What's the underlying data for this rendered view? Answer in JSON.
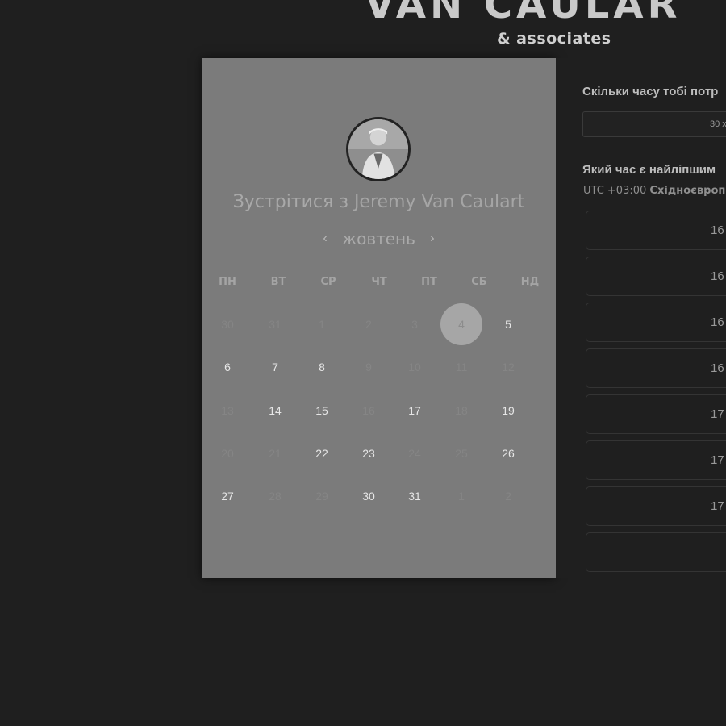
{
  "brand": {
    "title": "VAN CAULAR",
    "subtitle": "& associates"
  },
  "booking": {
    "meet_prefix": "Зустрітися з ",
    "host_name": "Jeremy Van Caulart",
    "calendar": {
      "prev_icon": "‹",
      "next_icon": "›",
      "month": "жовтень",
      "weekdays": [
        "ПН",
        "ВТ",
        "СР",
        "ЧТ",
        "ПТ",
        "СБ",
        "НД"
      ],
      "weeks": [
        [
          {
            "d": "30",
            "s": "muted"
          },
          {
            "d": "31",
            "s": "muted"
          },
          {
            "d": "1",
            "s": "muted"
          },
          {
            "d": "2",
            "s": "muted"
          },
          {
            "d": "3",
            "s": "muted"
          },
          {
            "d": "4",
            "s": "selected"
          },
          {
            "d": "5",
            "s": "avail"
          }
        ],
        [
          {
            "d": "6",
            "s": "avail"
          },
          {
            "d": "7",
            "s": "avail"
          },
          {
            "d": "8",
            "s": "avail"
          },
          {
            "d": "9",
            "s": "muted"
          },
          {
            "d": "10",
            "s": "muted"
          },
          {
            "d": "11",
            "s": "muted"
          },
          {
            "d": "12",
            "s": "muted"
          }
        ],
        [
          {
            "d": "13",
            "s": "muted"
          },
          {
            "d": "14",
            "s": "avail"
          },
          {
            "d": "15",
            "s": "avail"
          },
          {
            "d": "16",
            "s": "muted"
          },
          {
            "d": "17",
            "s": "avail"
          },
          {
            "d": "18",
            "s": "muted"
          },
          {
            "d": "19",
            "s": "avail"
          }
        ],
        [
          {
            "d": "20",
            "s": "muted"
          },
          {
            "d": "21",
            "s": "muted"
          },
          {
            "d": "22",
            "s": "avail"
          },
          {
            "d": "23",
            "s": "avail"
          },
          {
            "d": "24",
            "s": "muted"
          },
          {
            "d": "25",
            "s": "muted"
          },
          {
            "d": "26",
            "s": "avail"
          }
        ],
        [
          {
            "d": "27",
            "s": "avail"
          },
          {
            "d": "28",
            "s": "muted"
          },
          {
            "d": "29",
            "s": "muted"
          },
          {
            "d": "30",
            "s": "avail"
          },
          {
            "d": "31",
            "s": "avail"
          },
          {
            "d": "1",
            "s": "muted"
          },
          {
            "d": "2",
            "s": "muted"
          }
        ]
      ]
    },
    "duration": {
      "question": "Скільки часу тобі потр",
      "value": "30 х"
    },
    "time": {
      "question": "Який час є найліпшим",
      "tz_offset": "UTC +03:00 ",
      "tz_name": "Східноєвроп",
      "slots": [
        "16",
        "16",
        "16",
        "16",
        "17",
        "17",
        "17",
        ""
      ]
    }
  },
  "colors": {
    "page_bg": "#1f1f1f",
    "left_panel_bg": "#7b7b7b",
    "selected_day": "#a6a6a6"
  }
}
